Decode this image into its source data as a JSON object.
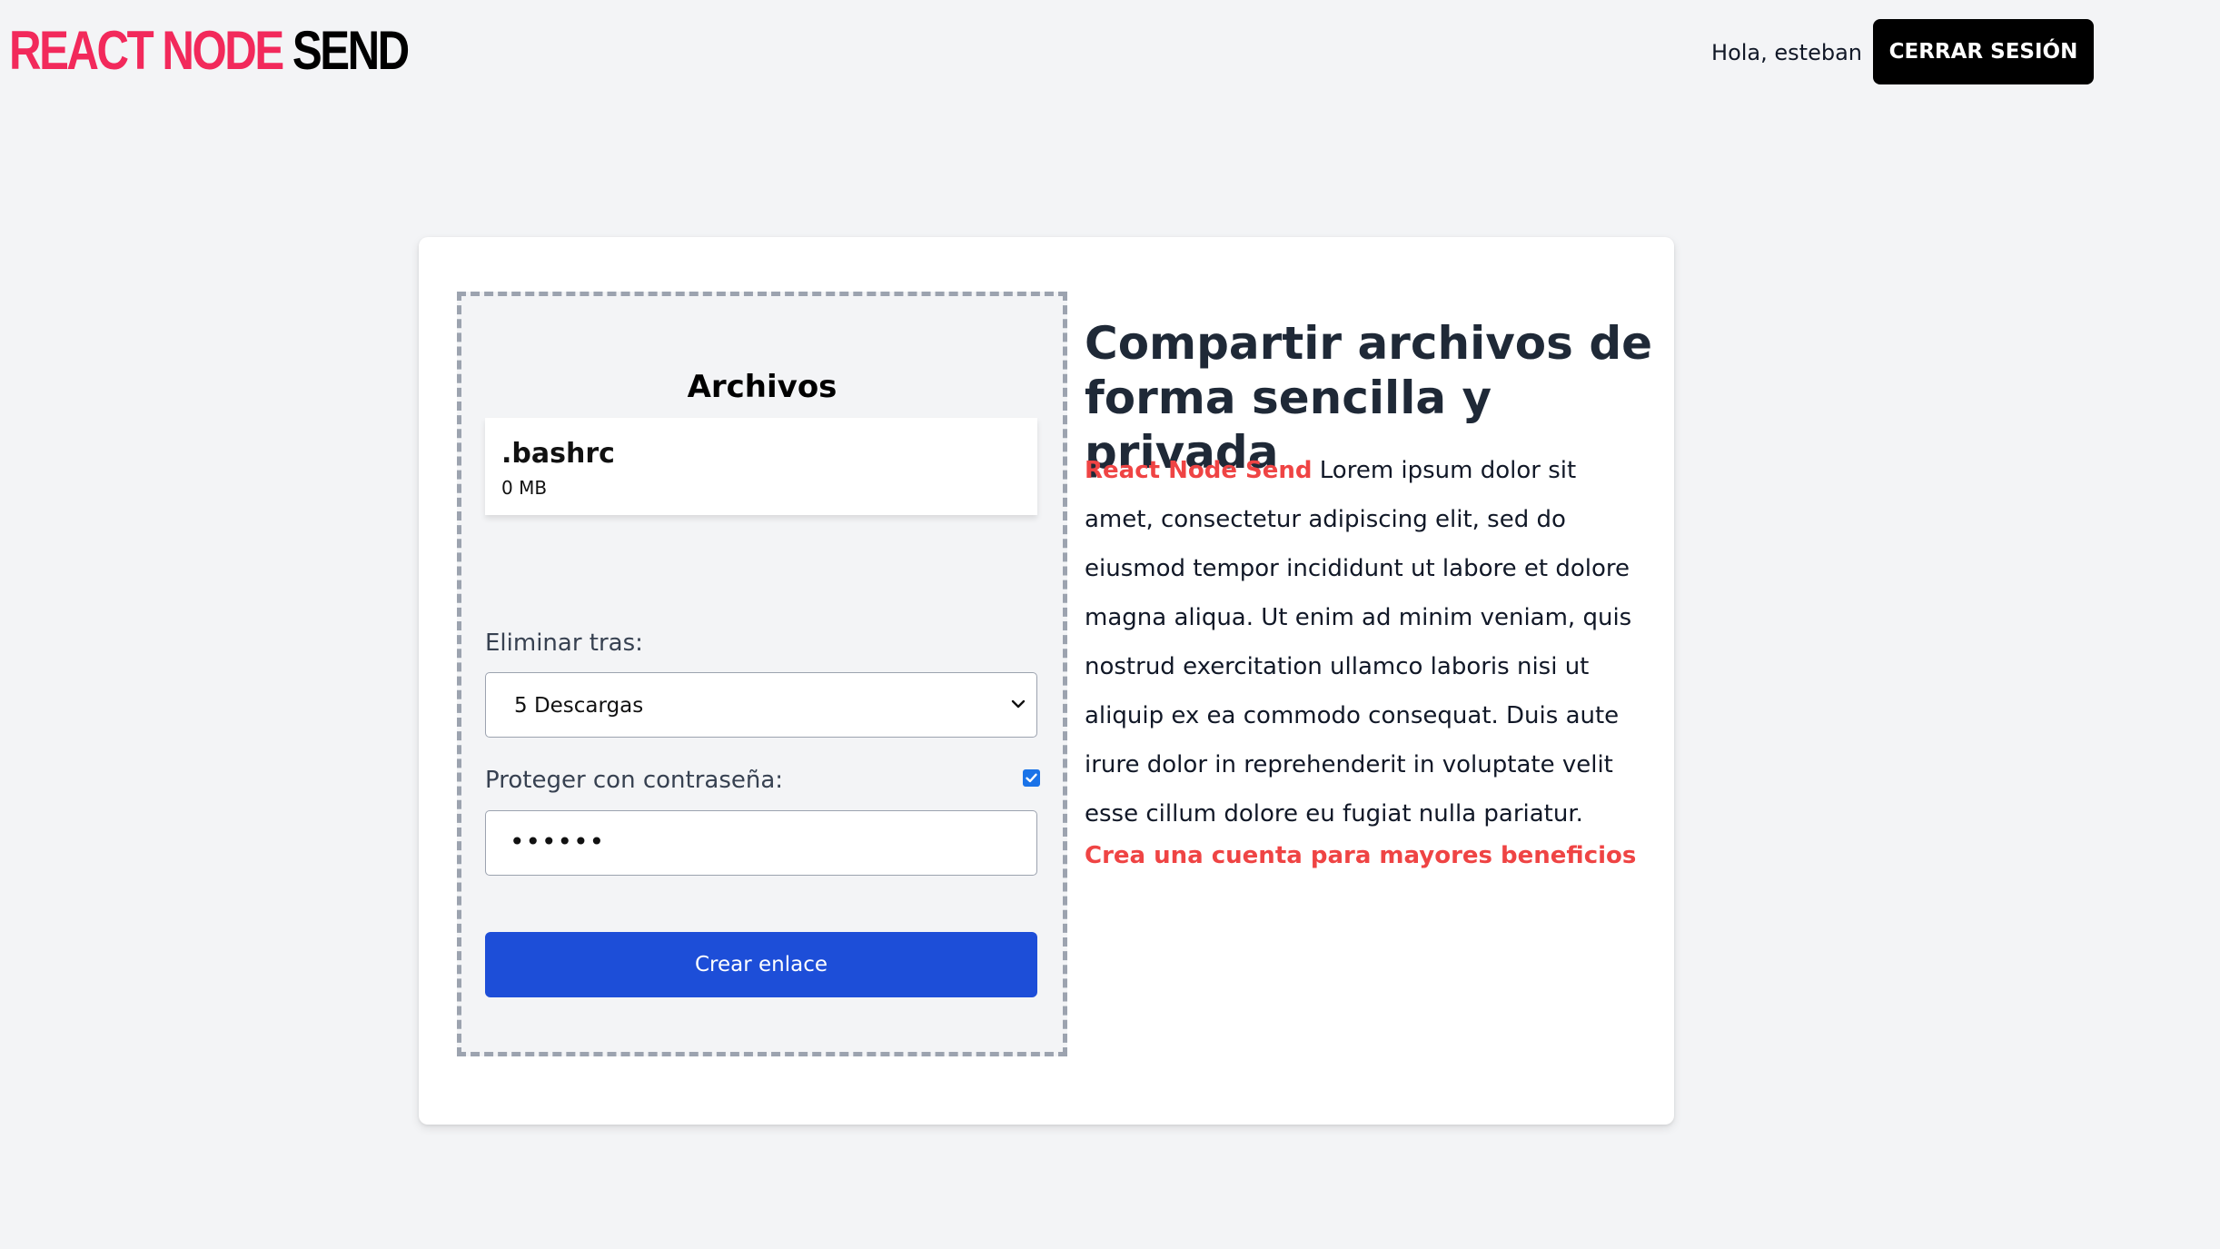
{
  "header": {
    "logo_part1": "REACT NODE",
    "logo_part2": "SEND",
    "greeting": "Hola, esteban",
    "logout_label": "CERRAR SESIÓN"
  },
  "upload": {
    "title": "Archivos",
    "files": [
      {
        "name": ".bashrc",
        "size": "0 MB"
      }
    ],
    "delete_label": "Eliminar tras:",
    "delete_selected": "5 Descargas",
    "password_label": "Proteger con contraseña:",
    "password_checked": true,
    "password_value": "••••••",
    "create_button": "Crear enlace"
  },
  "info": {
    "headline": "Compartir archivos de forma sencilla y privada",
    "brand": "React Node Send",
    "body": "Lorem ipsum dolor sit amet, consectetur adipiscing elit, sed do eiusmod tempor incididunt ut labore et dolore magna aliqua. Ut enim ad minim veniam, quis nostrud exercitation ullamco laboris nisi ut aliquip ex ea commodo consequat. Duis aute irure dolor in reprehenderit in voluptate velit esse cillum dolore eu fugiat nulla pariatur.",
    "cta": "Crea una cuenta para mayores beneficios"
  },
  "colors": {
    "brand_pink": "#f2295b",
    "accent_red": "#ef4444",
    "primary_blue": "#1d4ed8",
    "background": "#f3f4f6"
  }
}
